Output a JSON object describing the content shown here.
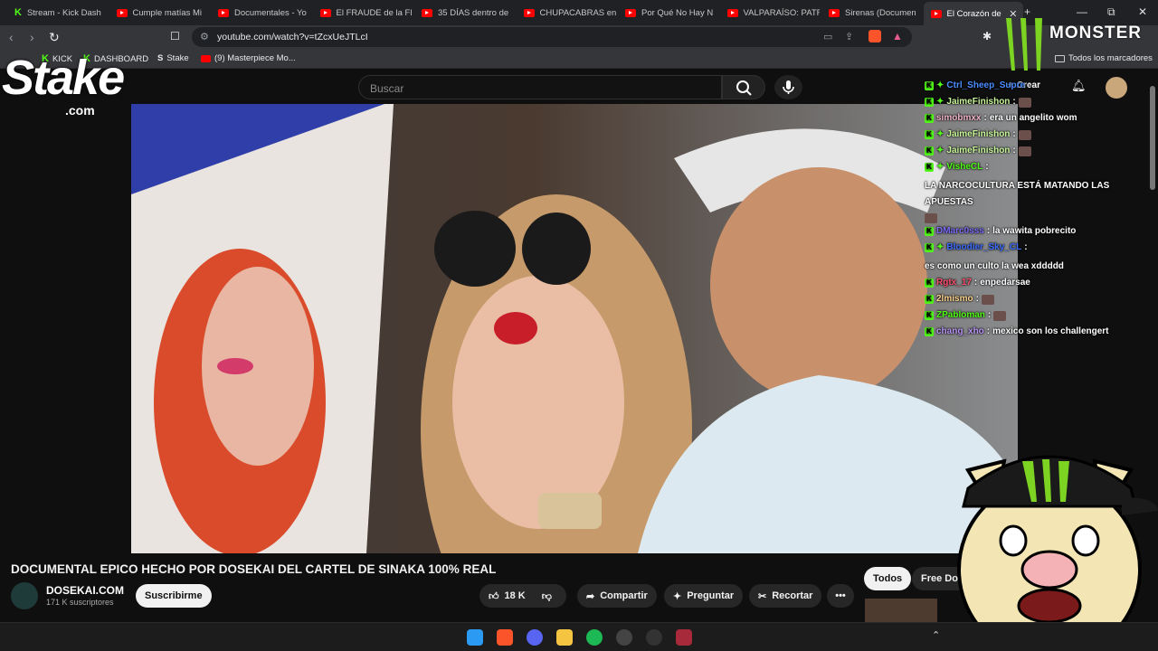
{
  "tabs": [
    {
      "label": "Stream - Kick Dash",
      "icon": "kick-icon"
    },
    {
      "label": "Cumple matías Mi",
      "icon": "youtube-icon"
    },
    {
      "label": "Documentales - Yo",
      "icon": "youtube-icon"
    },
    {
      "label": "El FRAUDE de la Fl",
      "icon": "youtube-icon"
    },
    {
      "label": "35 DÍAS dentro de",
      "icon": "youtube-icon"
    },
    {
      "label": "CHUPACABRAS en",
      "icon": "youtube-icon"
    },
    {
      "label": "Por Qué No Hay N",
      "icon": "youtube-icon"
    },
    {
      "label": "VALPARAÍSO: PATR",
      "icon": "youtube-icon"
    },
    {
      "label": "Sirenas (Documen",
      "icon": "youtube-icon"
    },
    {
      "label": "El Corazón de",
      "icon": "youtube-icon",
      "active": true
    }
  ],
  "address": {
    "url": "youtube.com/watch?v=tZcxUeJTLcI"
  },
  "bookmarks": {
    "items": [
      "KICK",
      "DASHBOARD",
      "Stake",
      "(9) Masterpiece Mo..."
    ],
    "all_label": "Todos los marcadores"
  },
  "overlay": {
    "stake_logo": "Stake",
    "stake_sub": ".com",
    "monster_logo": "MONSTER"
  },
  "youtube": {
    "search_placeholder": "Buscar",
    "create_label": "Crear",
    "video_title": "DOCUMENTAL EPICO HECHO POR DOSEKAI DEL CARTEL DE SINAKA 100% REAL",
    "channel_name": "DOSEKAI.COM",
    "subscribers": "171 K suscriptores",
    "subscribe_label": "Suscribirme",
    "likes": "18 K",
    "share_label": "Compartir",
    "ask_label": "Preguntar",
    "clip_label": "Recortar",
    "chips": [
      "Todos",
      "Free Doc"
    ]
  },
  "chat": [
    {
      "user": "Ctrl_Sheep_Supre",
      "text": "",
      "color": "#4a8cff",
      "badges": 2,
      "emote": false
    },
    {
      "user": "JaimeFinishon",
      "text": "",
      "color": "#c9f79b",
      "badges": 2,
      "emote": true
    },
    {
      "user": "simobmxx",
      "text": "era un angelito wom",
      "color": "#f0b3c8",
      "badges": 1,
      "emote": false
    },
    {
      "user": "JaimeFinishon",
      "text": "",
      "color": "#c9f79b",
      "badges": 2,
      "emote": true
    },
    {
      "user": "JaimeFinishon",
      "text": "",
      "color": "#c9f79b",
      "badges": 2,
      "emote": true
    },
    {
      "user": "VisheCL",
      "text": "LA NARCOCULTURA ESTÁ MATANDO LAS APUESTAS",
      "color": "#53fc18",
      "badges": 2,
      "emote": true
    },
    {
      "user": "DMarc0sss",
      "text": "la wawita pobrecito",
      "color": "#7b6cf6",
      "badges": 1,
      "emote": false
    },
    {
      "user": "Bloodier_Sky_CL",
      "text": "es como un culto la wea xddddd",
      "color": "#3b6cff",
      "badges": 2,
      "emote": false
    },
    {
      "user": "Rgtx_17",
      "text": "enpedarsae",
      "color": "#ff4d6d",
      "badges": 1,
      "emote": false
    },
    {
      "user": "2lmismo",
      "text": "",
      "color": "#fbd38d",
      "badges": 1,
      "emote": true
    },
    {
      "user": "ZPabloman",
      "text": "",
      "color": "#53fc18",
      "badges": 1,
      "emote": true
    },
    {
      "user": "chang_xho",
      "text": "mexico son los challengert",
      "color": "#b794f6",
      "badges": 1,
      "emote": false
    }
  ],
  "colors": {
    "kick_green": "#53fc18",
    "yt_red": "#ff0000",
    "monster_green": "#7dd321"
  }
}
